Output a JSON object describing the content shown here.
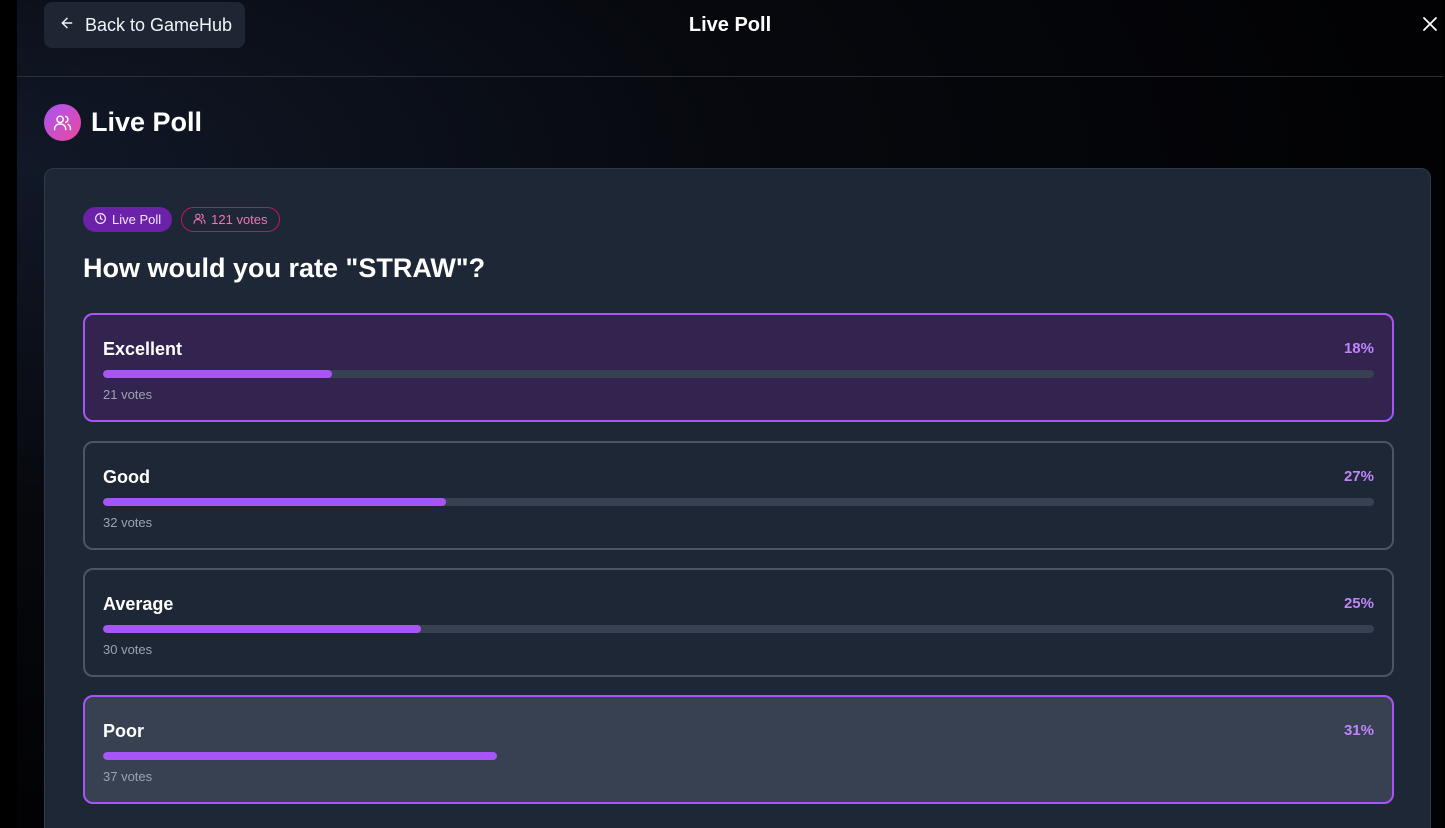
{
  "nav": {
    "back_label": "Back to GameHub",
    "title": "Live Poll"
  },
  "header": {
    "title": "Live Poll"
  },
  "poll": {
    "status_badge": "Live Poll",
    "votes_badge": "121 votes",
    "question": "How would you rate \"STRAW\"?",
    "options": [
      {
        "label": "Excellent",
        "percent": "18%",
        "votes": "21 votes",
        "fill": 0.18,
        "state": "highlighted",
        "bg": "#32234f"
      },
      {
        "label": "Good",
        "percent": "27%",
        "votes": "32 votes",
        "fill": 0.27,
        "state": "normal",
        "bg": "#1e2735"
      },
      {
        "label": "Average",
        "percent": "25%",
        "votes": "30 votes",
        "fill": 0.25,
        "state": "normal",
        "bg": "#1e2735"
      },
      {
        "label": "Poor",
        "percent": "31%",
        "votes": "37 votes",
        "fill": 0.31,
        "state": "selected",
        "bg": "#374151"
      }
    ]
  },
  "colors": {
    "accent": "#a855f7",
    "accent_text": "#c084fc",
    "pink": "#ec4899"
  },
  "icons": {
    "back": "arrow-left-icon",
    "close": "close-icon",
    "header": "users-icon",
    "status": "clock-icon",
    "votes": "users-icon"
  }
}
